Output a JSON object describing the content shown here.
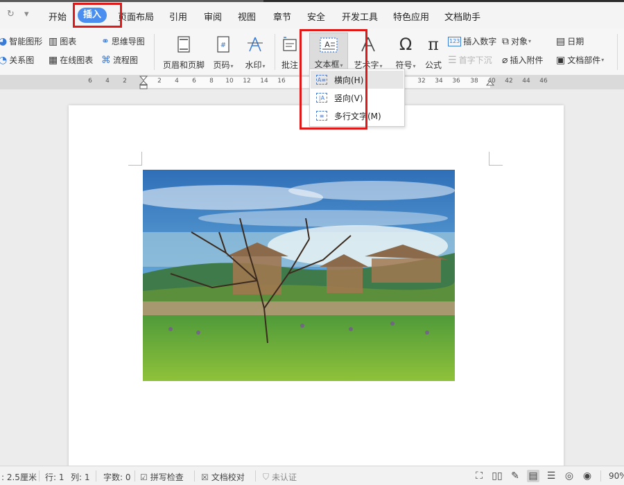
{
  "quick_access": {
    "redo": "↻",
    "customize": "▾"
  },
  "menu_tabs": [
    "开始",
    "插入",
    "页面布局",
    "引用",
    "审阅",
    "视图",
    "章节",
    "安全",
    "开发工具",
    "特色应用",
    "文档助手"
  ],
  "ribbon": {
    "smart_shape": "智能图形",
    "chart": "图表",
    "mind_map": "思维导图",
    "relation_chart": "关系图",
    "online_chart": "在线图表",
    "flowchart": "流程图",
    "header_footer": "页眉和页脚",
    "page_number": "页码",
    "watermark": "水印",
    "comment": "批注",
    "textbox": "文本框",
    "textbox_icon_text": "A",
    "wordart": "艺术字",
    "symbol": "符号",
    "formula": "公式",
    "insert_number": "插入数字",
    "insert_number_icon": "123",
    "drop_cap": "首字下沉",
    "object": "对象",
    "attachment": "插入附件",
    "date": "日期",
    "doc_parts": "文档部件"
  },
  "ruler_numbers": [
    "6",
    "4",
    "2",
    "2",
    "4",
    "6",
    "8",
    "10",
    "12",
    "14",
    "16",
    "32",
    "34",
    "36",
    "38",
    "40",
    "42",
    "44",
    "46"
  ],
  "textbox_menu": {
    "items": [
      {
        "label": "横向(H)",
        "icon": "A≡"
      },
      {
        "label": "竖向(V)",
        "icon": "|A"
      },
      {
        "label": "多行文字(M)",
        "icon": "≡"
      }
    ]
  },
  "status_bar": {
    "position": ": 2.5厘米",
    "row": "行: 1",
    "col": "列: 1",
    "word_count": "字数: 0",
    "spell_check": "拼写检查",
    "doc_proof": "文档校对",
    "not_certified": "未认证",
    "zoom": "90%"
  },
  "colors": {
    "accent": "#4a8ff0",
    "highlight": "#e01818"
  }
}
